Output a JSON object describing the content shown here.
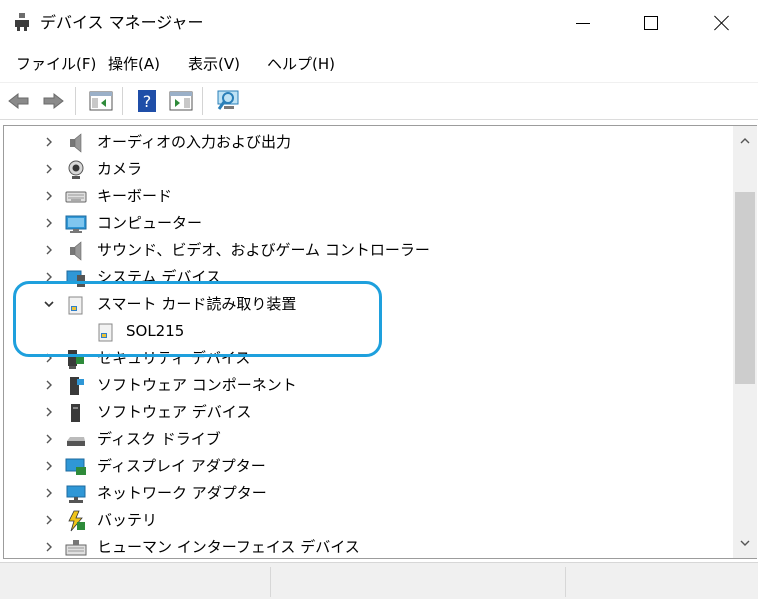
{
  "window": {
    "title": "デバイス マネージャー"
  },
  "menu": [
    "ファイル(F)",
    "操作(A)",
    "表示(V)",
    "ヘルプ(H)"
  ],
  "toolbar": {
    "buttons": [
      "back-arrow-icon",
      "forward-arrow-icon",
      "show-hide-console-tree-icon",
      "help-icon",
      "action-pane-icon",
      "scan-hardware-icon"
    ]
  },
  "tree": {
    "items": [
      {
        "label": "オーディオの入力および出力",
        "expanded": false,
        "icon": "speaker-icon"
      },
      {
        "label": "カメラ",
        "expanded": false,
        "icon": "camera-icon"
      },
      {
        "label": "キーボード",
        "expanded": false,
        "icon": "keyboard-icon"
      },
      {
        "label": "コンピューター",
        "expanded": false,
        "icon": "computer-icon"
      },
      {
        "label": "サウンド、ビデオ、およびゲーム コントローラー",
        "expanded": false,
        "icon": "sound-controller-icon"
      },
      {
        "label": "システム デバイス",
        "expanded": false,
        "icon": "system-device-icon"
      },
      {
        "label": "スマート カード読み取り装置",
        "expanded": true,
        "icon": "smart-card-reader-icon"
      },
      {
        "label": "SOL215",
        "child": true,
        "icon": "smart-card-reader-icon"
      },
      {
        "label": "セキュリティ デバイス",
        "expanded": false,
        "icon": "security-device-icon"
      },
      {
        "label": "ソフトウェア コンポーネント",
        "expanded": false,
        "icon": "software-component-icon"
      },
      {
        "label": "ソフトウェア デバイス",
        "expanded": false,
        "icon": "software-device-icon"
      },
      {
        "label": "ディスク ドライブ",
        "expanded": false,
        "icon": "disk-drive-icon"
      },
      {
        "label": "ディスプレイ アダプター",
        "expanded": false,
        "icon": "display-adapter-icon"
      },
      {
        "label": "ネットワーク アダプター",
        "expanded": false,
        "icon": "network-adapter-icon"
      },
      {
        "label": "バッテリ",
        "expanded": false,
        "icon": "battery-icon"
      },
      {
        "label": "ヒューマン インターフェイス デバイス",
        "expanded": false,
        "icon": "hid-icon"
      }
    ]
  },
  "colors": {
    "highlight": "#1ea0dd",
    "scroll_thumb": "#cdcdcd",
    "statusbar": "#f0f0f0"
  }
}
